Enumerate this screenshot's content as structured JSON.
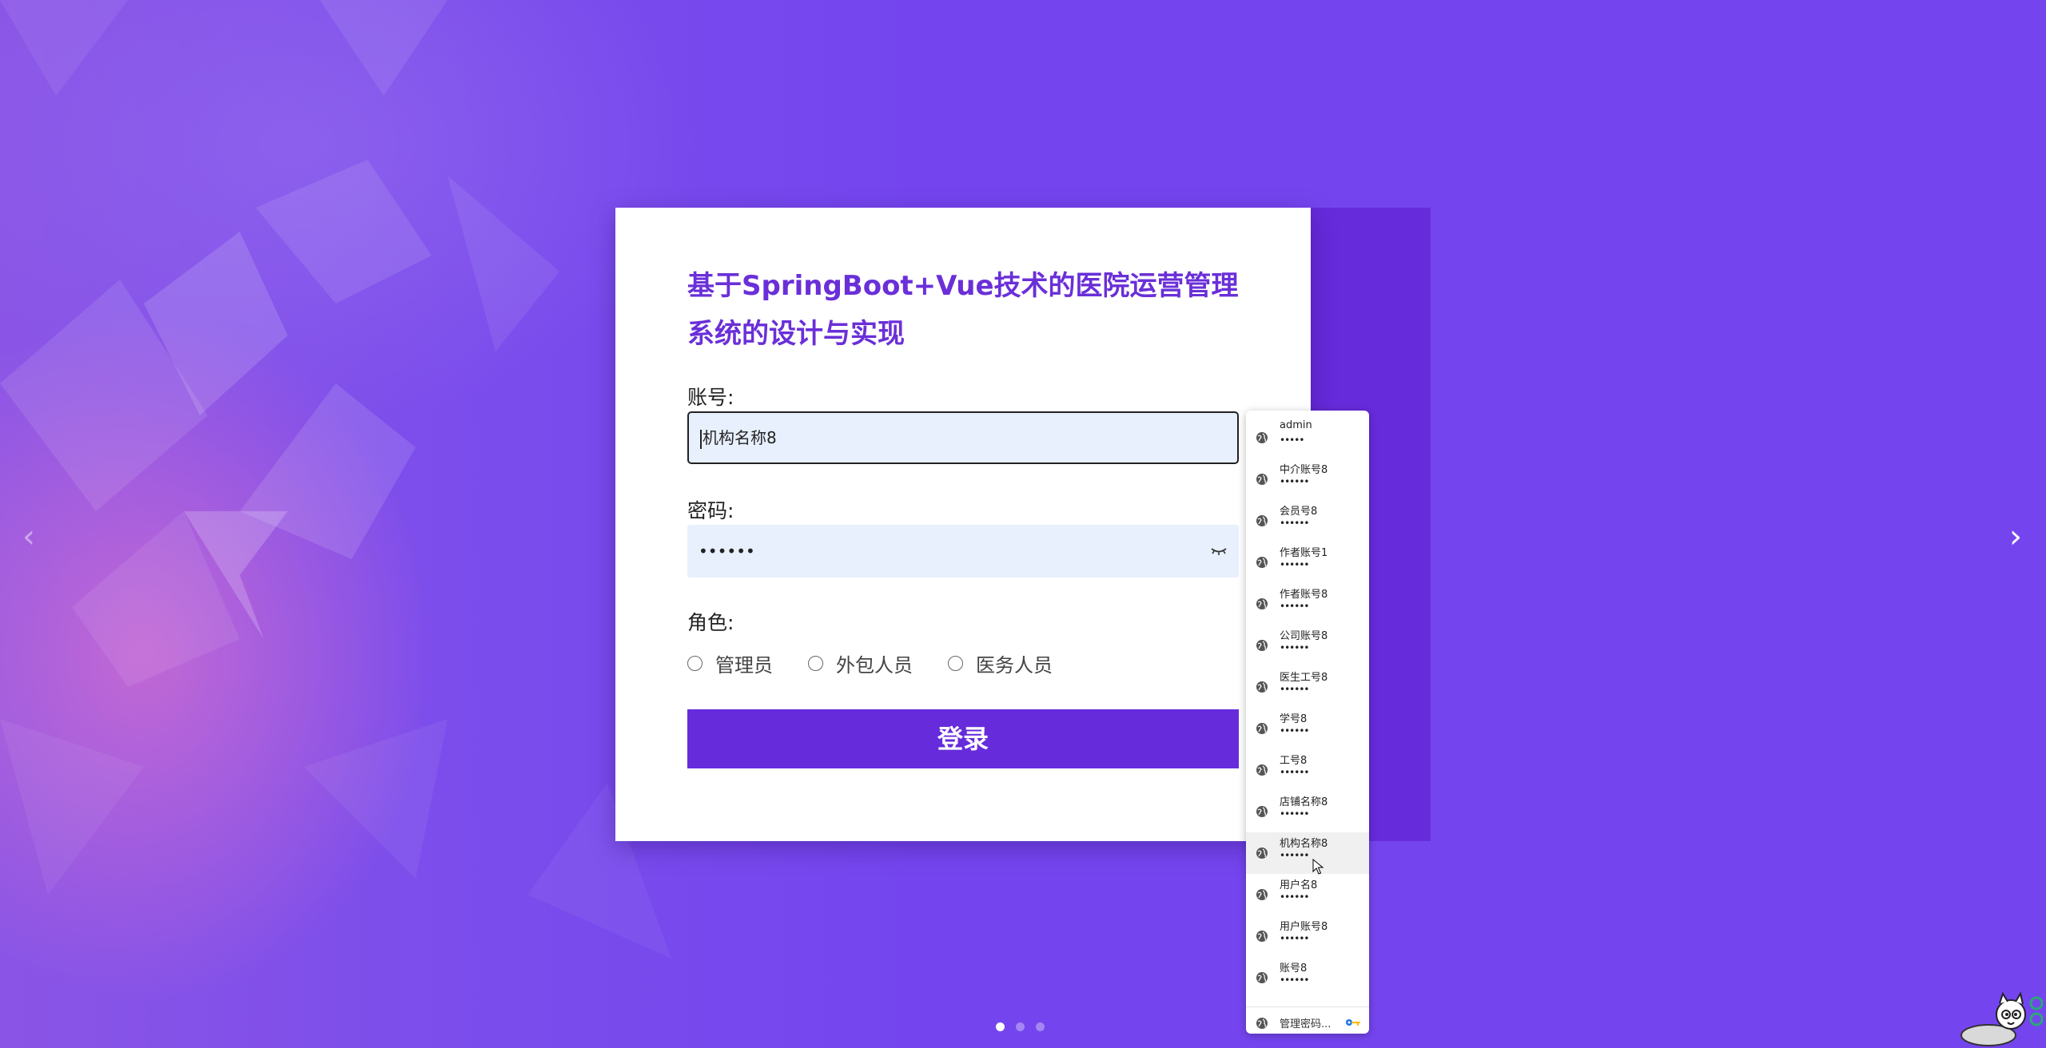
{
  "page": {
    "title": "基于SpringBoot+Vue技术的医院运营管理系统的设计与实现"
  },
  "form": {
    "account_label": "账号:",
    "account_value": "机构名称8",
    "password_label": "密码:",
    "password_value": "••••••",
    "role_label": "角色:",
    "roles": [
      "管理员",
      "外包人员",
      "医务人员"
    ],
    "login_label": "登录"
  },
  "carousel": {
    "slides": 3,
    "active_index": 0,
    "prev_icon": "chevron-left-icon",
    "next_icon": "chevron-right-icon"
  },
  "autofill": {
    "items": [
      {
        "user": "admin",
        "pass": "•••••"
      },
      {
        "user": "中介账号8",
        "pass": "••••••"
      },
      {
        "user": "会员号8",
        "pass": "••••••"
      },
      {
        "user": "作者账号1",
        "pass": "••••••"
      },
      {
        "user": "作者账号8",
        "pass": "••••••"
      },
      {
        "user": "公司账号8",
        "pass": "••••••"
      },
      {
        "user": "医生工号8",
        "pass": "••••••"
      },
      {
        "user": "学号8",
        "pass": "••••••"
      },
      {
        "user": "工号8",
        "pass": "••••••"
      },
      {
        "user": "店铺名称8",
        "pass": "••••••"
      },
      {
        "user": "机构名称8",
        "pass": "••••••"
      },
      {
        "user": "用户名8",
        "pass": "••••••"
      },
      {
        "user": "用户账号8",
        "pass": "••••••"
      },
      {
        "user": "账号8",
        "pass": "••••••"
      }
    ],
    "hovered_index": 10,
    "footer_label": "管理密码..."
  },
  "colors": {
    "brand": "#662bdb",
    "title": "#6a2fd8",
    "background": "#7445ee",
    "input_fill": "#e8f0fe"
  }
}
